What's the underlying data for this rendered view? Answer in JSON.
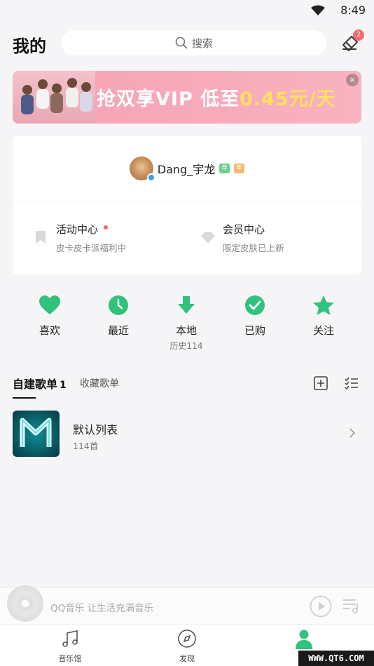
{
  "status_bar": {
    "time": "8:49"
  },
  "header": {
    "title": "我的",
    "search_placeholder": "搜索",
    "skin_badge_count": "2"
  },
  "banner": {
    "text_prefix": "抢双享VIP 低至",
    "text_highlight": "0.45元/天",
    "close": "×"
  },
  "profile": {
    "username": "Dang_宇龙",
    "badges": [
      "年",
      "年"
    ],
    "entries": [
      {
        "title": "活动中心",
        "subtitle": "皮卡皮卡派福利中",
        "has_dot": true
      },
      {
        "title": "会员中心",
        "subtitle": "限定皮肤已上新",
        "has_dot": false
      }
    ]
  },
  "quick_actions": [
    {
      "label": "喜欢",
      "icon": "heart-icon"
    },
    {
      "label": "最近",
      "icon": "clock-icon"
    },
    {
      "label": "本地",
      "sub": "历史114",
      "icon": "download-icon"
    },
    {
      "label": "已购",
      "icon": "check-circle-icon"
    },
    {
      "label": "关注",
      "icon": "star-icon"
    }
  ],
  "playlist_tabs": {
    "active": "自建歌单",
    "active_count": "1",
    "other": "收藏歌单"
  },
  "playlists": [
    {
      "name": "默认列表",
      "count": "114首"
    }
  ],
  "mini_player": {
    "text": "QQ音乐 让生活充满音乐"
  },
  "bottom_nav": [
    {
      "label": "音乐馆",
      "icon": "music-note-icon"
    },
    {
      "label": "发现",
      "icon": "compass-icon"
    },
    {
      "label": "",
      "icon": "profile-icon"
    }
  ],
  "watermark": "WWW.QT6.COM",
  "colors": {
    "accent": "#31c27c",
    "banner": "#f7a9b9",
    "highlight": "#ffe25c"
  }
}
